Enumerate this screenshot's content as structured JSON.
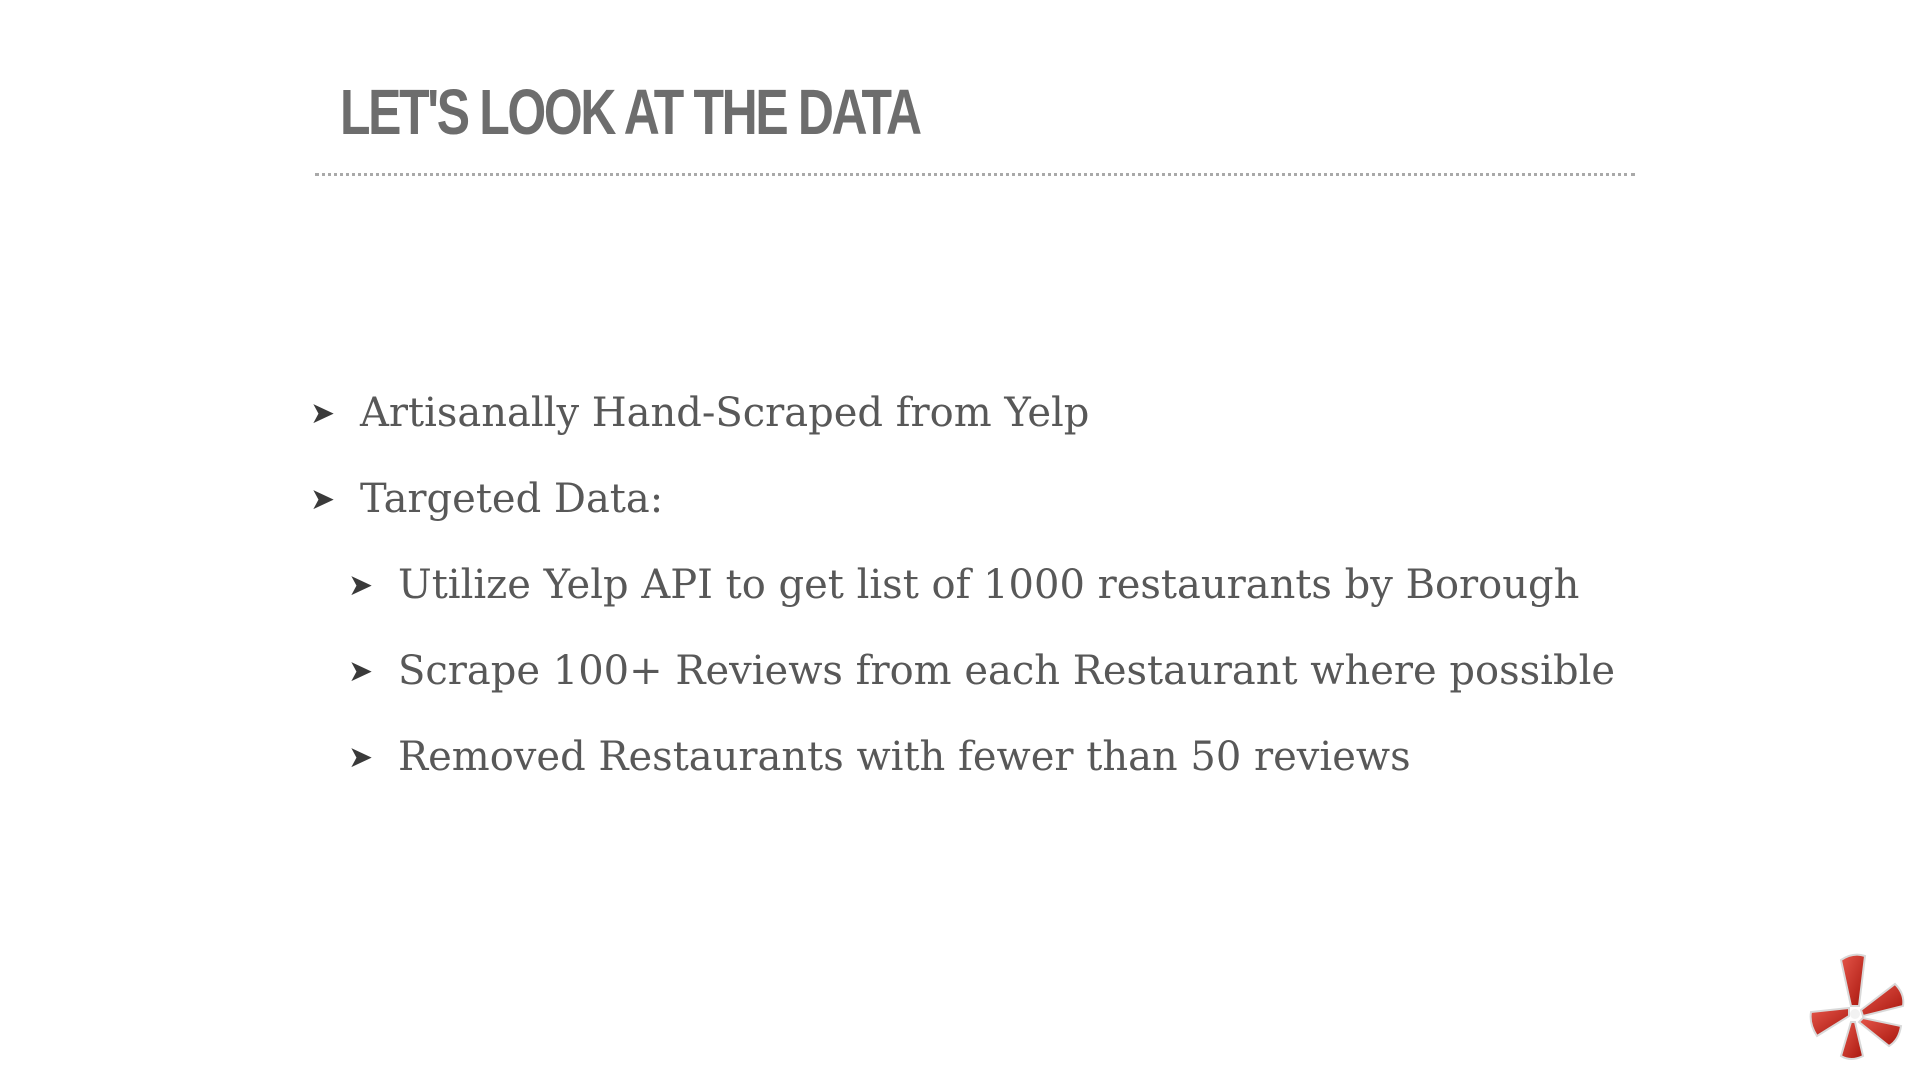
{
  "slide": {
    "title": "LET'S LOOK AT THE DATA",
    "bullets": [
      {
        "level": 1,
        "text": "Artisanally Hand-Scraped from Yelp"
      },
      {
        "level": 1,
        "text": "Targeted Data:"
      },
      {
        "level": 2,
        "text": "Utilize Yelp API to get list of 1000 restaurants by Borough"
      },
      {
        "level": 2,
        "text": "Scrape 100+ Reviews from each Restaurant where possible"
      },
      {
        "level": 2,
        "text": "Removed Restaurants with fewer than 50 reviews"
      }
    ],
    "bullet_glyph": "➤",
    "logo_icon": "yelp-burst-icon"
  },
  "colors": {
    "title": "#6d6d6d",
    "body_text": "#585858",
    "divider": "#a9a9a9",
    "logo_red": "#c4281c"
  }
}
